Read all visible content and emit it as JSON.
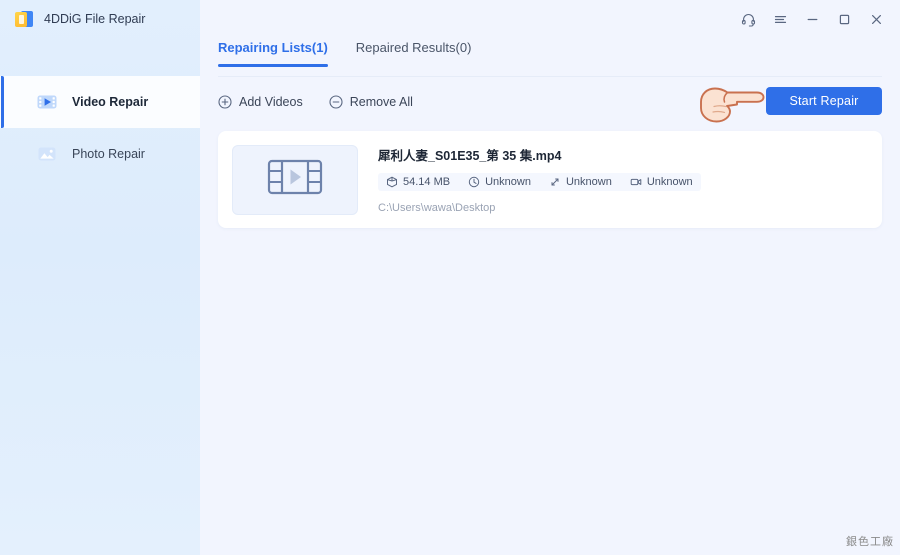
{
  "window": {
    "title": "4DDiG File Repair",
    "logo_icon": "app-logo-icon",
    "controls": [
      {
        "name": "support-headset",
        "icon": "headset-icon",
        "label": ""
      },
      {
        "name": "menu",
        "icon": "hamburger-menu-icon",
        "label": ""
      },
      {
        "name": "minimize",
        "icon": "minimize-icon",
        "label": ""
      },
      {
        "name": "maximize",
        "icon": "maximize-icon",
        "label": ""
      },
      {
        "name": "close",
        "icon": "close-icon",
        "label": ""
      }
    ]
  },
  "sidebar": {
    "items": [
      {
        "label": "Video Repair",
        "icon": "video-film-icon",
        "active": true
      },
      {
        "label": "Photo Repair",
        "icon": "photo-image-icon",
        "active": false
      }
    ]
  },
  "main": {
    "tabs": [
      {
        "label": "Repairing Lists(1)",
        "active": true
      },
      {
        "label": "Repaired Results(0)",
        "active": false
      }
    ],
    "toolbar": {
      "add_videos_label": "Add Videos",
      "add_videos_icon": "plus-circle-icon",
      "remove_all_label": "Remove All",
      "remove_all_icon": "minus-circle-icon",
      "start_repair_label": "Start Repair"
    },
    "files": [
      {
        "name": "犀利人妻_S01E35_第 35 集.mp4",
        "thumbnail_icon": "video-filmstrip-play-icon",
        "meta": [
          {
            "icon": "package-size-icon",
            "value": "54.14 MB"
          },
          {
            "icon": "clock-duration-icon",
            "value": "Unknown"
          },
          {
            "icon": "resolution-arrows-icon",
            "value": "Unknown"
          },
          {
            "icon": "video-camera-icon",
            "value": "Unknown"
          }
        ],
        "path": "C:\\Users\\wawa\\Desktop"
      }
    ]
  },
  "cursor": {
    "icon": "pointing-hand-cursor",
    "target": "Start Repair"
  },
  "watermark": {
    "text": "銀色工廠"
  },
  "colors": {
    "accent": "#2f6fe8",
    "sidebar": "#dfeefd",
    "content_bg": "#f2f5fe",
    "card_bg": "#ffffff",
    "meta_bg": "#f4f7fe"
  }
}
